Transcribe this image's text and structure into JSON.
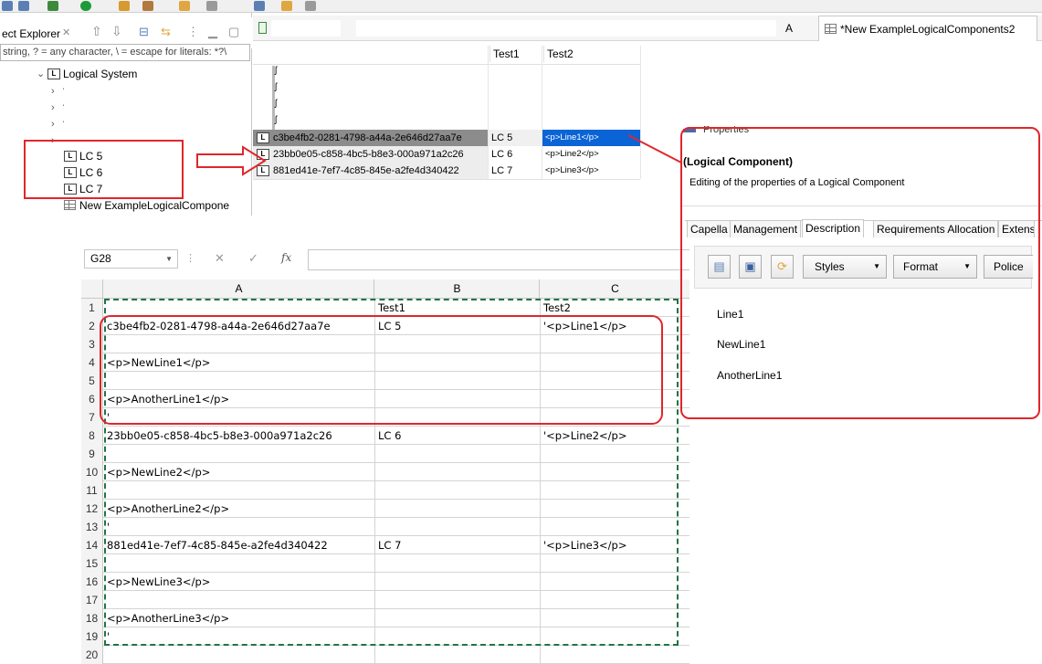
{
  "explorer": {
    "title": "ect Explorer",
    "filter_placeholder": "string, ? = any character, \\ = escape for literals: *?\\",
    "tree": {
      "root_label": "Logical System",
      "components": [
        "LC 5",
        "LC 6",
        "LC 7"
      ],
      "table_label": "New ExampleLogicalCompone"
    }
  },
  "editor": {
    "tab_partial": "A",
    "tab_label": "*New ExampleLogicalComponents2",
    "columns": [
      "Test1",
      "Test2"
    ],
    "rows": [
      {
        "id": "c3be4fb2-0281-4798-a44a-2e646d27aa7e",
        "test1": "LC 5",
        "test2": "<p>Line1</p>"
      },
      {
        "id": "23bb0e05-c858-4bc5-b8e3-000a971a2c26",
        "test1": "LC 6",
        "test2": "<p>Line2</p>"
      },
      {
        "id": "881ed41e-7ef7-4c85-845e-a2fe4d340422",
        "test1": "LC 7",
        "test2": "<p>Line3</p>"
      }
    ]
  },
  "properties": {
    "view_title": "Properties",
    "heading": "(Logical Component)",
    "description": "Editing of the properties of a Logical Component",
    "tabs": [
      "Capella",
      "Management",
      "Description",
      "Requirements Allocation",
      "Extens"
    ],
    "active_tab": "Description",
    "toolbar": {
      "styles": "Styles",
      "format": "Format",
      "police": "Police"
    },
    "content_lines": [
      "Line1",
      "NewLine1",
      "AnotherLine1"
    ]
  },
  "spreadsheet": {
    "name_box": "G28",
    "fx": "fx",
    "columns": [
      "A",
      "B",
      "C"
    ],
    "rows": [
      {
        "n": "1",
        "a": "",
        "b": "Test1",
        "c": "Test2"
      },
      {
        "n": "2",
        "a": "c3be4fb2-0281-4798-a44a-2e646d27aa7e",
        "b": "LC 5",
        "c": "'<p>Line1</p>"
      },
      {
        "n": "3",
        "a": "",
        "b": "",
        "c": ""
      },
      {
        "n": "4",
        "a": "<p>NewLine1</p>",
        "b": "",
        "c": ""
      },
      {
        "n": "5",
        "a": "",
        "b": "",
        "c": ""
      },
      {
        "n": "6",
        "a": "<p>AnotherLine1</p>",
        "b": "",
        "c": ""
      },
      {
        "n": "7",
        "a": "'",
        "b": "",
        "c": ""
      },
      {
        "n": "8",
        "a": "23bb0e05-c858-4bc5-b8e3-000a971a2c26",
        "b": "LC 6",
        "c": "'<p>Line2</p>"
      },
      {
        "n": "9",
        "a": "",
        "b": "",
        "c": ""
      },
      {
        "n": "10",
        "a": "<p>NewLine2</p>",
        "b": "",
        "c": ""
      },
      {
        "n": "11",
        "a": "",
        "b": "",
        "c": ""
      },
      {
        "n": "12",
        "a": "<p>AnotherLine2</p>",
        "b": "",
        "c": ""
      },
      {
        "n": "13",
        "a": "'",
        "b": "",
        "c": ""
      },
      {
        "n": "14",
        "a": "881ed41e-7ef7-4c85-845e-a2fe4d340422",
        "b": "LC 7",
        "c": "'<p>Line3</p>"
      },
      {
        "n": "15",
        "a": "",
        "b": "",
        "c": ""
      },
      {
        "n": "16",
        "a": "<p>NewLine3</p>",
        "b": "",
        "c": ""
      },
      {
        "n": "17",
        "a": "",
        "b": "",
        "c": ""
      },
      {
        "n": "18",
        "a": "<p>AnotherLine3</p>",
        "b": "",
        "c": ""
      },
      {
        "n": "19",
        "a": "'",
        "b": "",
        "c": ""
      },
      {
        "n": "20",
        "a": "",
        "b": "",
        "c": ""
      }
    ]
  },
  "colors": {
    "annotation_red": "#e0262b",
    "selection_blue": "#0a64d6",
    "selection_gray": "#8c8c8c",
    "copy_marquee_green": "#217346"
  }
}
